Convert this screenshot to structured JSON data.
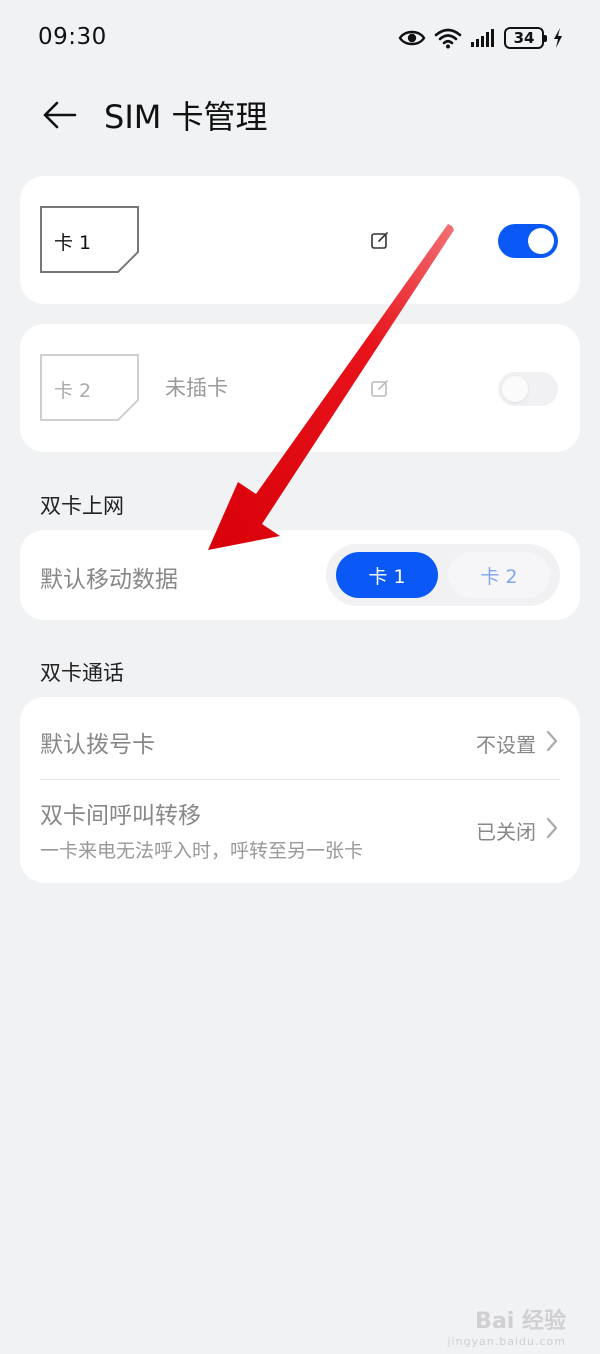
{
  "status_bar": {
    "time": "09:30",
    "battery": "34",
    "icons": [
      "eye-icon",
      "wifi-icon",
      "signal-icon",
      "battery-icon",
      "charging-icon"
    ]
  },
  "header": {
    "title": "SIM 卡管理",
    "back_icon": "arrow-left-icon"
  },
  "sim_cards": [
    {
      "label": "卡 1",
      "status": "",
      "enabled": true
    },
    {
      "label": "卡 2",
      "status": "未插卡",
      "enabled": false
    }
  ],
  "dual_data": {
    "section_title": "双卡上网",
    "row_label": "默认移动数据",
    "options": [
      "卡 1",
      "卡 2"
    ],
    "selected": "卡 1"
  },
  "dual_call": {
    "section_title": "双卡通话",
    "default_dial": {
      "label": "默认拨号卡",
      "value": "不设置"
    },
    "call_forward": {
      "label": "双卡间呼叫转移",
      "sub": "一卡来电无法呼入时，呼转至另一张卡",
      "value": "已关闭"
    }
  },
  "watermark": {
    "main": "Bai 经验",
    "sub": "jingyan.baidu.com"
  },
  "colors": {
    "accent": "#0a59f7",
    "background": "#f1f2f4",
    "annotation_arrow": "#e8141b"
  }
}
